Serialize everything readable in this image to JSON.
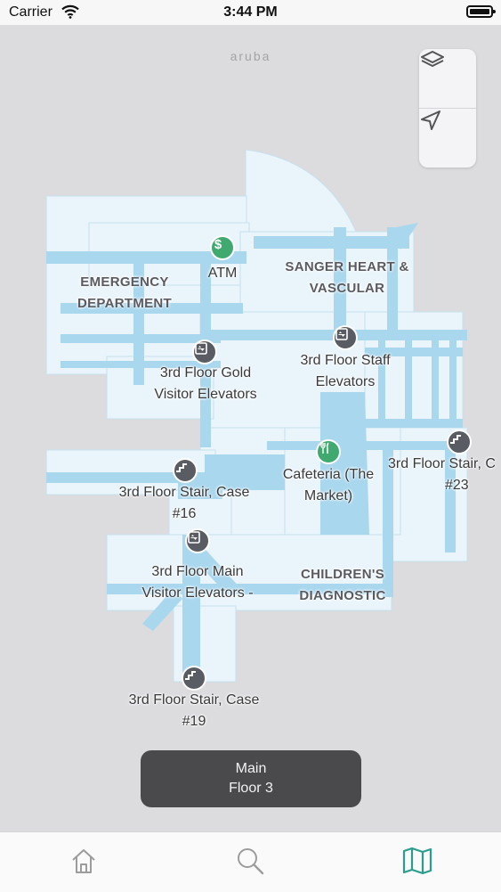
{
  "status_bar": {
    "carrier": "Carrier",
    "time": "3:44 PM"
  },
  "map": {
    "brand": "aruba",
    "areas": [
      {
        "line1": "EMERGENCY",
        "line2": "DEPARTMENT"
      },
      {
        "line1": "SANGER HEART &",
        "line2": "VASCULAR"
      },
      {
        "line1": "CHILDREN'S",
        "line2": "DIAGNOSTIC"
      }
    ],
    "pois": [
      {
        "icon": "dollar-icon",
        "line1": "ATM",
        "line2": ""
      },
      {
        "icon": "elevator-icon",
        "line1": "3rd Floor Gold",
        "line2": "Visitor Elevators"
      },
      {
        "icon": "elevator-icon",
        "line1": "3rd Floor Staff",
        "line2": "Elevators"
      },
      {
        "icon": "fork-knife-icon",
        "line1": "Cafeteria (The",
        "line2": "Market)"
      },
      {
        "icon": "stairs-icon",
        "line1": "3rd Floor Stair, C",
        "line2": "#23"
      },
      {
        "icon": "stairs-icon",
        "line1": "3rd Floor Stair, Case",
        "line2": "#16"
      },
      {
        "icon": "elevator-icon",
        "line1": "3rd Floor Main",
        "line2": "Visitor Elevators -"
      },
      {
        "icon": "stairs-icon",
        "line1": "3rd Floor Stair, Case",
        "line2": "#19"
      }
    ],
    "controls": [
      {
        "icon": "layers-icon"
      },
      {
        "icon": "location-arrow-icon"
      }
    ]
  },
  "floor_selector": {
    "building": "Main",
    "floor": "Floor 3"
  },
  "tab_bar": [
    {
      "icon": "home-icon",
      "active": false
    },
    {
      "icon": "search-icon",
      "active": false
    },
    {
      "icon": "map-icon",
      "active": true
    }
  ],
  "colors": {
    "accent": "#2a9d8f",
    "corridor": "#a9d7ee",
    "room": "#eaf5fb",
    "poi_dark": "#595d63",
    "poi_green": "#3fa970"
  }
}
